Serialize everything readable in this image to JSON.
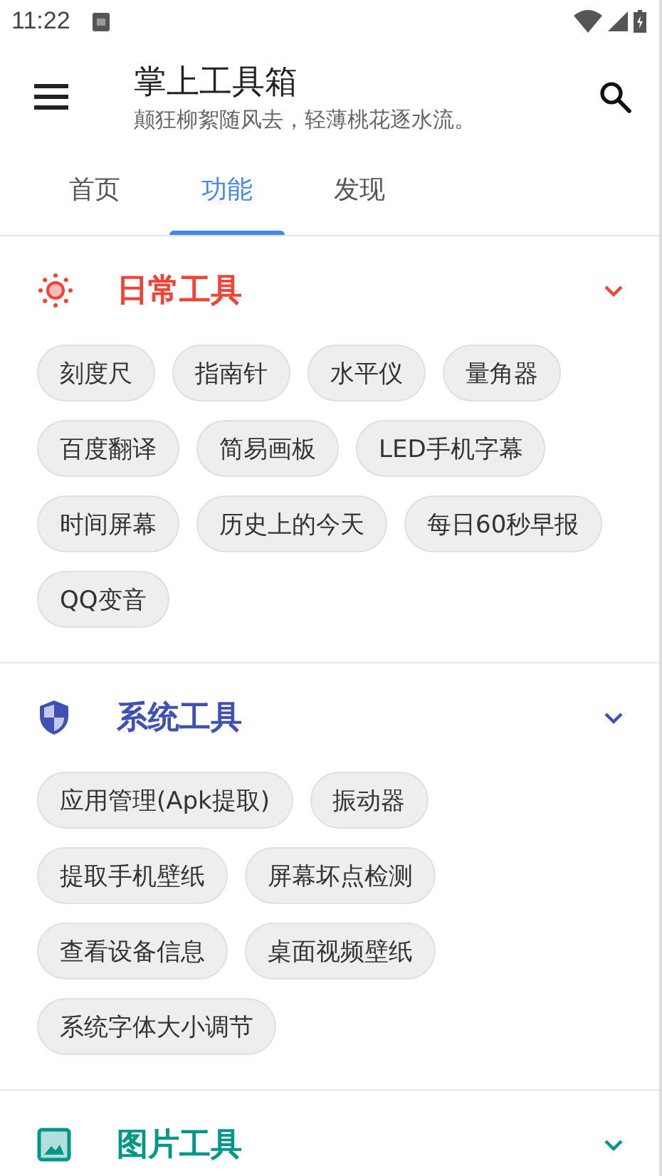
{
  "status_bar": {
    "time": "11:22"
  },
  "app_bar": {
    "title": "掌上工具箱",
    "subtitle": "颠狂柳絮随风去，轻薄桃花逐水流。"
  },
  "tabs": [
    {
      "label": "首页",
      "selected": false
    },
    {
      "label": "功能",
      "selected": true
    },
    {
      "label": "发现",
      "selected": false
    }
  ],
  "sections": [
    {
      "title": "日常工具",
      "kind": "sun",
      "color": "#f44336",
      "items": [
        "刻度尺",
        "指南针",
        "水平仪",
        "量角器",
        "百度翻译",
        "简易画板",
        "LED手机字幕",
        "时间屏幕",
        "历史上的今天",
        "每日60秒早报",
        "QQ变音"
      ]
    },
    {
      "title": "系统工具",
      "kind": "shield",
      "color": "#3f51b5",
      "items": [
        "应用管理(Apk提取)",
        "振动器",
        "提取手机壁纸",
        "屏幕坏点检测",
        "查看设备信息",
        "桌面视频壁纸",
        "系统字体大小调节"
      ]
    },
    {
      "title": "图片工具",
      "kind": "image",
      "color": "#009688"
    }
  ]
}
